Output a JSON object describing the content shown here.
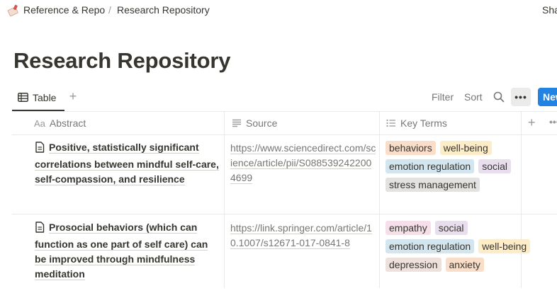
{
  "breadcrumb": {
    "parent": "Reference & Repo",
    "separator": "/",
    "current": "Research Repository",
    "share": "Sha"
  },
  "page": {
    "title": "Research Repository"
  },
  "viewbar": {
    "tab_label": "Table",
    "add_view": "+",
    "filter": "Filter",
    "sort": "Sort",
    "more": "•••",
    "new": "New"
  },
  "table": {
    "columns": {
      "abstract": "Abstract",
      "source": "Source",
      "key_terms": "Key Terms",
      "add": "+",
      "more": "•••"
    },
    "rows": [
      {
        "abstract": "Positive, statistically significant correlations between mindful self-care, self-compassion, and resilience",
        "source": "https://www.sciencedirect.com/science/article/pii/S0885392422004699",
        "tags": [
          {
            "label": "behaviors",
            "color": "#fadec9"
          },
          {
            "label": "well-being",
            "color": "#fdecc8"
          },
          {
            "label": "emotion regulation",
            "color": "#d3e5ef"
          },
          {
            "label": "social",
            "color": "#e8deee"
          },
          {
            "label": "stress management",
            "color": "#e3e2e0"
          }
        ]
      },
      {
        "abstract": "Prosocial behaviors (which can function as one part of self care) can be improved through mindfulness meditation",
        "source": "https://link.springer.com/article/10.1007/s12671-017-0841-8",
        "tags": [
          {
            "label": "empathy",
            "color": "#f5e0e9"
          },
          {
            "label": "social",
            "color": "#e8deee"
          },
          {
            "label": "emotion regulation",
            "color": "#d3e5ef"
          },
          {
            "label": "well-being",
            "color": "#fdecc8"
          },
          {
            "label": "depression",
            "color": "#eee0da"
          },
          {
            "label": "anxiety",
            "color": "#fadec9"
          }
        ]
      }
    ]
  },
  "colors": {
    "accent": "#2383e2",
    "text": "#37352f",
    "muted": "#787774",
    "border": "#e9e9e7"
  }
}
